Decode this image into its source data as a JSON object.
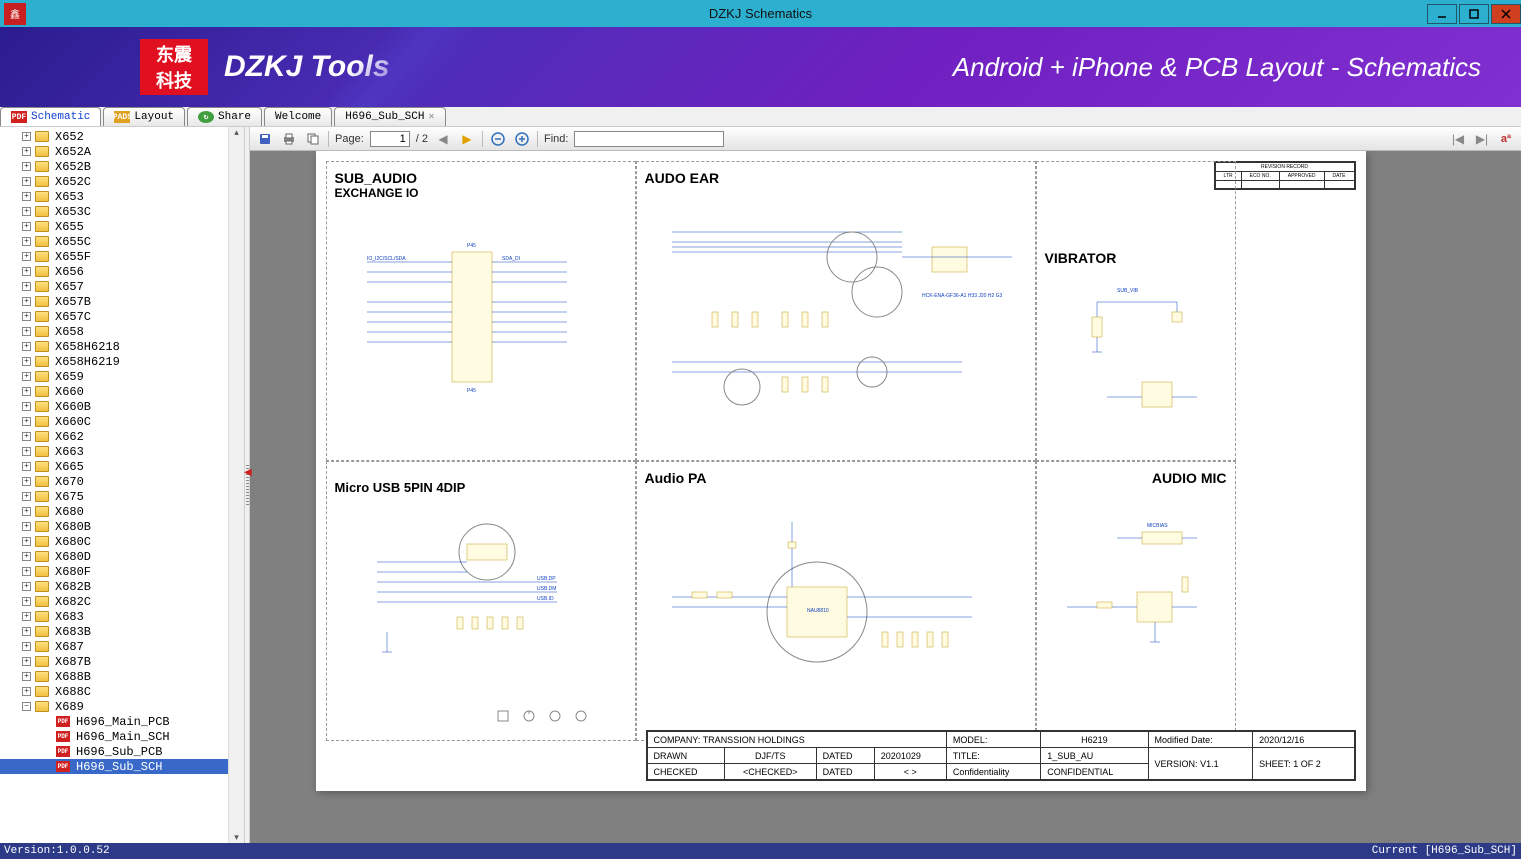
{
  "window": {
    "title": "DZKJ Schematics"
  },
  "banner": {
    "logo_cn1": "东震",
    "logo_cn2": "科技",
    "title": "DZKJ Tools",
    "subtitle": "Android + iPhone & PCB Layout - Schematics"
  },
  "tabs": {
    "schematic": "Schematic",
    "layout": "Layout",
    "share": "Share",
    "welcome": "Welcome",
    "doc": "H696_Sub_SCH"
  },
  "tree": {
    "folders": [
      "X652",
      "X652A",
      "X652B",
      "X652C",
      "X653",
      "X653C",
      "X655",
      "X655C",
      "X655F",
      "X656",
      "X657",
      "X657B",
      "X657C",
      "X658",
      "X658H6218",
      "X658H6219",
      "X659",
      "X660",
      "X660B",
      "X660C",
      "X662",
      "X663",
      "X665",
      "X670",
      "X675",
      "X680",
      "X680B",
      "X680C",
      "X680D",
      "X680F",
      "X682B",
      "X682C",
      "X683",
      "X683B",
      "X687",
      "X687B",
      "X688B",
      "X688C"
    ],
    "expanded": "X689",
    "children": [
      "H696_Main_PCB",
      "H696_Main_SCH",
      "H696_Sub_PCB",
      "H696_Sub_SCH"
    ],
    "selected": "H696_Sub_SCH"
  },
  "toolbar": {
    "page_label": "Page:",
    "page_current": "1",
    "page_total": "/ 2",
    "find_label": "Find:",
    "find_value": ""
  },
  "schematic": {
    "cells": {
      "c1_title": "SUB_AUDIO",
      "c1_sub": "EXCHANGE IO",
      "c2_title": "AUDO EAR",
      "c3_title": "VIBRATOR",
      "c4_title": "Micro USB 5PIN 4DIP",
      "c5_title": "Audio PA",
      "c6_title": "AUDIO MIC"
    },
    "revbox": {
      "h1": "REVISION RECORD",
      "c1": "LTR",
      "c2": "ECO NO.",
      "c3": "APPROVED",
      "c4": "DATE"
    },
    "titleblock": {
      "company_l": "COMPANY:",
      "company_v": "TRANSSION HOLDINGS",
      "drawn_l": "DRAWN",
      "drawn_v": "DJF/TS",
      "dated1_l": "DATED",
      "dated1_v": "20201029",
      "checked_l": "CHECKED",
      "checked_v": "<CHECKED>",
      "dated2_l": "DATED",
      "dated2_v": "<  >",
      "model_l": "MODEL:",
      "model_v": "H6219",
      "title_l": "TITLE:",
      "title_v": "1_SUB_AU",
      "conf_l": "Confidentiality",
      "conf_v": "CONFIDENTIAL",
      "moddate_l": "Modified Date:",
      "moddate_v": "2020/12/16",
      "version_l": "VERSION:",
      "version_v": "V1.1",
      "sheet_l": "SHEET:",
      "sheet_v": "1   OF     2"
    }
  },
  "statusbar": {
    "version": "Version:1.0.0.52",
    "current": "Current [H696_Sub_SCH]"
  }
}
